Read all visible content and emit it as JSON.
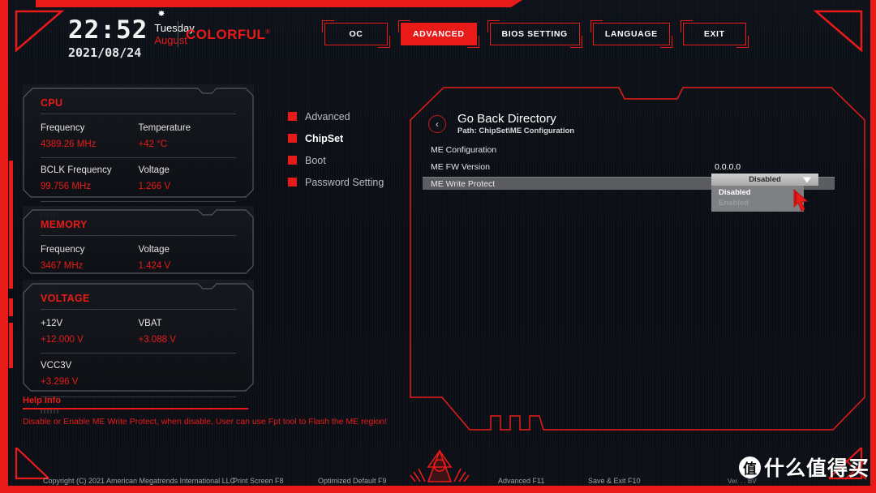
{
  "header": {
    "time": "22:52",
    "date": "2021/08/24",
    "weekday": "Tuesday",
    "month": "August",
    "brand": "COLORFUL",
    "brand_mark": "®",
    "gear_icon": "gear-icon",
    "nav": [
      {
        "label": "OC",
        "active": false
      },
      {
        "label": "ADVANCED",
        "active": true
      },
      {
        "label": "BIOS SETTING",
        "active": false
      },
      {
        "label": "LANGUAGE",
        "active": false
      },
      {
        "label": "EXIT",
        "active": false
      }
    ]
  },
  "sidebar": {
    "cards": [
      {
        "title": "CPU",
        "rows": [
          [
            {
              "label": "Frequency",
              "value": "4389.26 MHz"
            },
            {
              "label": "Temperature",
              "value": "+42 °C"
            }
          ],
          [
            {
              "label": "BCLK Frequency",
              "value": "99.756 MHz"
            },
            {
              "label": "Voltage",
              "value": "1.266 V"
            }
          ]
        ]
      },
      {
        "title": "MEMORY",
        "rows": [
          [
            {
              "label": "Frequency",
              "value": "3467 MHz"
            },
            {
              "label": "Voltage",
              "value": "1.424 V"
            }
          ]
        ]
      },
      {
        "title": "VOLTAGE",
        "rows": [
          [
            {
              "label": "+12V",
              "value": "+12.000 V"
            },
            {
              "label": "VBAT",
              "value": "+3.088 V"
            }
          ],
          [
            {
              "label": "VCC3V",
              "value": "+3.296 V"
            },
            {
              "label": "",
              "value": ""
            }
          ]
        ]
      }
    ],
    "help": {
      "title": "Help Info",
      "text": "Disable or Enable ME Write Protect, when disable, User can use Fpt tool to Flash the ME region!"
    }
  },
  "menu": {
    "items": [
      {
        "label": "Advanced",
        "active": false
      },
      {
        "label": "ChipSet",
        "active": true
      },
      {
        "label": "Boot",
        "active": false
      },
      {
        "label": "Password Setting",
        "active": false
      }
    ]
  },
  "main": {
    "back": {
      "icon": "chevron-left-icon",
      "title": "Go Back Directory",
      "path": "Path: ChipSet\\ME Configuration"
    },
    "settings": [
      {
        "label": "ME Configuration",
        "value": "",
        "selected": false,
        "section": true
      },
      {
        "label": "ME FW Version",
        "value": "0.0.0.0",
        "selected": false,
        "section": false
      },
      {
        "label": "ME Write Protect",
        "value": "",
        "selected": true,
        "section": false
      }
    ],
    "dropdown": {
      "selected": "Disabled",
      "arrow_icon": "chevron-down-icon",
      "options": [
        {
          "label": "Disabled",
          "enabled": true
        },
        {
          "label": "Enabled",
          "enabled": false
        }
      ]
    },
    "cursor_icon": "mouse-cursor-icon"
  },
  "footer": {
    "copyright": "Copyright (C) 2021 American Megatrends International LLC",
    "print_screen": "Print Screen F8",
    "optimized_default": "Optimized Default F9",
    "advanced": "Advanced F11",
    "save_exit": "Save & Exit F10",
    "version": "Ver.  .  . BV",
    "emblem_icon": "colorful-star-emblem-icon"
  },
  "watermark": {
    "badge": "值",
    "text": "什么值得买"
  },
  "colors": {
    "accent_red": "#e81b18",
    "background": "#0d1119",
    "text_primary": "#ffffff",
    "text_muted": "#9fa2a8",
    "selected_row": "#5b5d61"
  }
}
